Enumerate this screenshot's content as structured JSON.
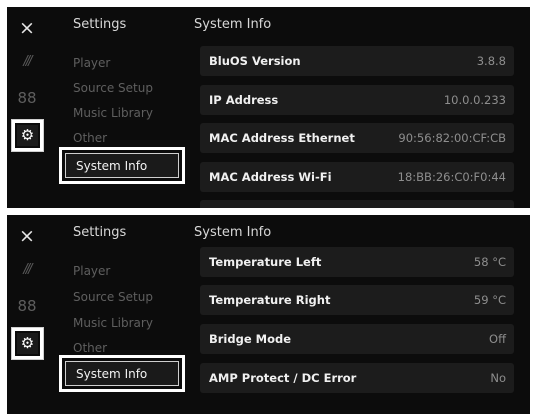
{
  "rail": {
    "close_icon": "×",
    "lines_icon": "///",
    "grid_icon": "88",
    "gear_icon": "⚙"
  },
  "menu": {
    "title": "Settings",
    "items": [
      "Player",
      "Source Setup",
      "Music Library",
      "Other"
    ],
    "selected": "System Info"
  },
  "content": {
    "title": "System Info"
  },
  "panel1_rows": [
    {
      "label": "BluOS Version",
      "value": "3.8.8"
    },
    {
      "label": "IP Address",
      "value": "10.0.0.233"
    },
    {
      "label": "MAC Address Ethernet",
      "value": "90:56:82:00:CF:CB"
    },
    {
      "label": "MAC Address Wi-Fi",
      "value": "18:BB:26:C0:F0:44"
    }
  ],
  "panel2_rows": [
    {
      "label": "Temperature Left",
      "value": "58 °C"
    },
    {
      "label": "Temperature Right",
      "value": "59 °C"
    },
    {
      "label": "Bridge Mode",
      "value": "Off"
    },
    {
      "label": "AMP Protect / DC Error",
      "value": "No"
    }
  ]
}
